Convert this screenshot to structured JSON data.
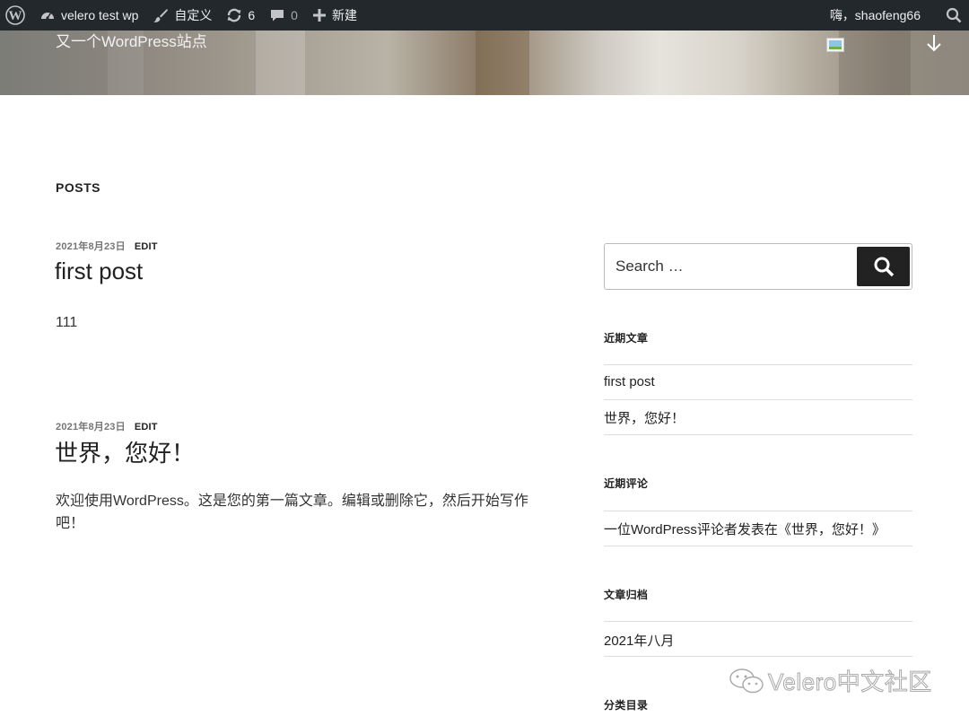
{
  "admin_bar": {
    "wp_logo_icon": "wordpress-logo-icon",
    "site_name": "velero test wp",
    "customize_label": "自定义",
    "updates_count": "6",
    "comments_count": "0",
    "new_label": "新建",
    "greeting": "嗨，shaofeng66",
    "search_icon": "search-icon"
  },
  "header": {
    "site_description": "又一个WordPress站点",
    "scroll_icon": "arrow-down-icon"
  },
  "main": {
    "heading": "POSTS",
    "posts": [
      {
        "date": "2021年8月23日",
        "edit_label": "EDIT",
        "title": "first post",
        "excerpt": "111"
      },
      {
        "date": "2021年8月23日",
        "edit_label": "EDIT",
        "title": "世界，您好！",
        "excerpt": "欢迎使用WordPress。这是您的第一篇文章。编辑或删除它，然后开始写作吧！"
      }
    ]
  },
  "sidebar": {
    "search": {
      "placeholder": "Search …"
    },
    "recent_posts": {
      "title": "近期文章",
      "items": [
        "first post",
        "世界，您好！"
      ]
    },
    "recent_comments": {
      "title": "近期评论",
      "items": [
        "一位WordPress评论者发表在《世界，您好！》"
      ]
    },
    "archives": {
      "title": "文章归档",
      "items": [
        "2021年八月"
      ]
    },
    "categories": {
      "title": "分类目录"
    }
  },
  "watermark": {
    "text": "Velero中文社区"
  },
  "colors": {
    "admin_bar_bg": "#23282d",
    "search_button_bg": "#222222",
    "meta_gray": "#767676"
  }
}
